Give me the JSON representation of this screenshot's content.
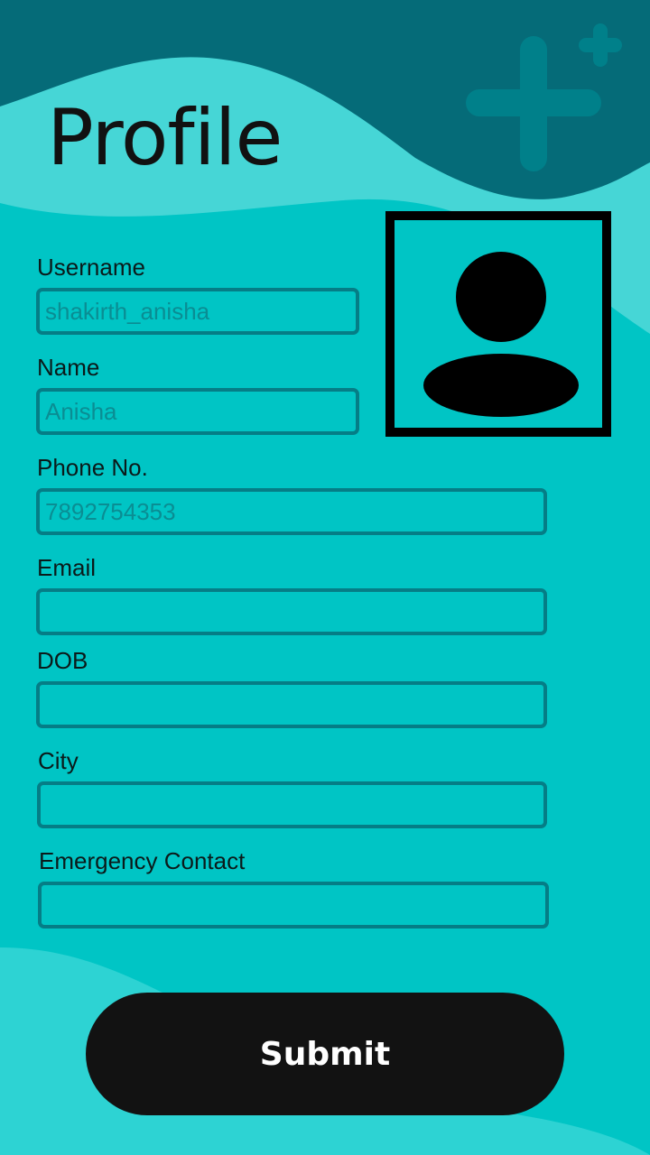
{
  "header": {
    "title": "Profile"
  },
  "form": {
    "fields": [
      {
        "label": "Username",
        "placeholder": "shakirth_anisha"
      },
      {
        "label": "Name",
        "placeholder": "Anisha"
      },
      {
        "label": "Phone No.",
        "placeholder": "7892754353"
      },
      {
        "label": "Email",
        "placeholder": ""
      },
      {
        "label": "DOB",
        "placeholder": ""
      },
      {
        "label": "City",
        "placeholder": ""
      },
      {
        "label": "Emergency Contact",
        "placeholder": ""
      }
    ],
    "submit_label": "Submit"
  },
  "icons": {
    "avatar": "user-avatar-icon",
    "decoration": "medical-plus-icon"
  },
  "colors": {
    "background": "#00c5c5",
    "header_wave": "#056b78",
    "light_wave": "#46d6d6",
    "input_border": "#057d86",
    "button": "#121212"
  }
}
